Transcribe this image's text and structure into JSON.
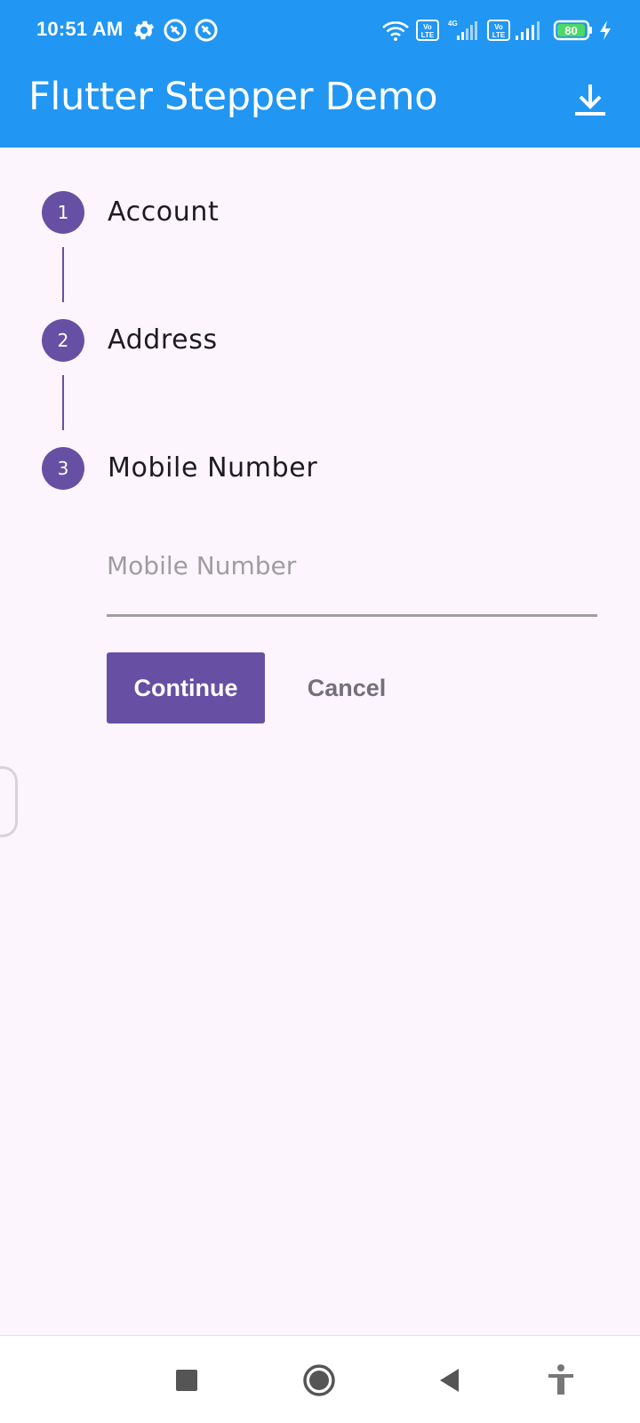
{
  "status_bar": {
    "time": "10:51 AM",
    "battery_level": "80",
    "network_label": "4G",
    "volte_label": "Vo LTE"
  },
  "app_bar": {
    "title": "Flutter Stepper Demo",
    "action_icon": "download-icon"
  },
  "stepper": {
    "steps": [
      {
        "number": "1",
        "title": "Account"
      },
      {
        "number": "2",
        "title": "Address"
      },
      {
        "number": "3",
        "title": "Mobile Number"
      }
    ],
    "current_step": 3
  },
  "form": {
    "mobile_placeholder": "Mobile Number",
    "mobile_value": ""
  },
  "controls": {
    "continue_label": "Continue",
    "cancel_label": "Cancel"
  },
  "nav_bar": {
    "icons": [
      "recents-square-icon",
      "home-circle-icon",
      "back-triangle-icon",
      "accessibility-icon"
    ]
  },
  "colors": {
    "app_bar": "#2196F3",
    "primary": "#6750A4",
    "background": "#FCF5FD",
    "cancel_text": "#74707A",
    "field_underline": "#9E9E9E"
  }
}
